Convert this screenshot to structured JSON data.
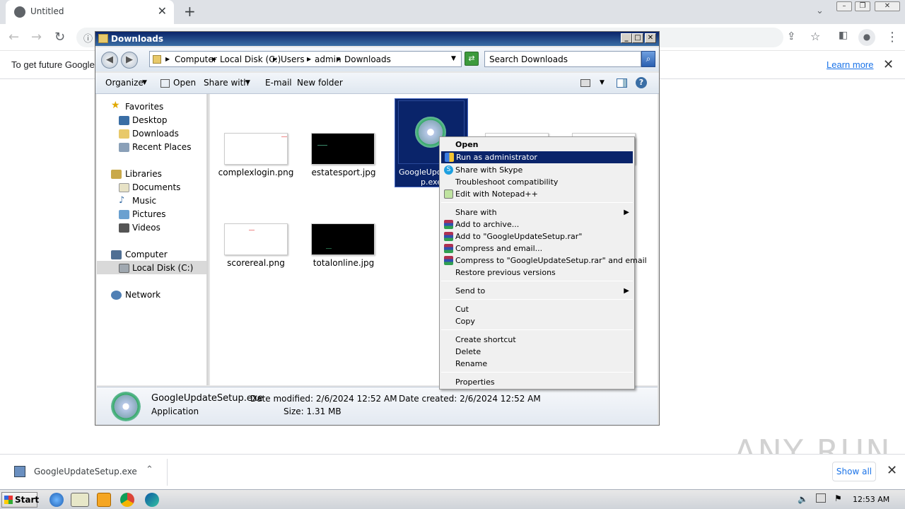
{
  "browser": {
    "tab_title": "Untitled",
    "infobar_message": "To get future Google",
    "learn_more": "Learn more"
  },
  "explorer": {
    "title": "Downloads",
    "breadcrumbs": [
      "Computer",
      "Local Disk (C:)",
      "Users",
      "admin",
      "Downloads"
    ],
    "search_placeholder": "Search Downloads",
    "commands": {
      "organize": "Organize",
      "open": "Open",
      "share_with": "Share with",
      "email": "E-mail",
      "new_folder": "New folder"
    },
    "nav": {
      "favorites": "Favorites",
      "desktop": "Desktop",
      "downloads": "Downloads",
      "recent_places": "Recent Places",
      "libraries": "Libraries",
      "documents": "Documents",
      "music": "Music",
      "pictures": "Pictures",
      "videos": "Videos",
      "computer": "Computer",
      "local_disk": "Local Disk (C:)",
      "network": "Network"
    },
    "files": [
      {
        "name": "complexlogin.png"
      },
      {
        "name": "estatesport.jpg"
      },
      {
        "name": "GoogleUpda",
        "name2": "p.exe"
      },
      {
        "name": "scorereal.png"
      },
      {
        "name": "totalonline.jpg"
      }
    ],
    "details": {
      "filename": "GoogleUpdateSetup.exe",
      "type": "Application",
      "date_modified": "Date modified: 2/6/2024 12:52 AM",
      "size": "Size: 1.31 MB",
      "date_created": "Date created: 2/6/2024 12:52 AM"
    }
  },
  "context_menu": {
    "open": "Open",
    "run_as_admin": "Run as administrator",
    "share_skype": "Share with Skype",
    "troubleshoot": "Troubleshoot compatibility",
    "edit_notepad": "Edit with Notepad++",
    "share_with": "Share with",
    "add_archive": "Add to archive...",
    "add_rar": "Add to \"GoogleUpdateSetup.rar\"",
    "compress_email": "Compress and email...",
    "compress_rar_email": "Compress to \"GoogleUpdateSetup.rar\" and email",
    "restore": "Restore previous versions",
    "send_to": "Send to",
    "cut": "Cut",
    "copy": "Copy",
    "create_shortcut": "Create shortcut",
    "delete": "Delete",
    "rename": "Rename",
    "properties": "Properties"
  },
  "downloads_bar": {
    "filename": "GoogleUpdateSetup.exe",
    "show_all": "Show all"
  },
  "watermark": "ANY RUN",
  "taskbar": {
    "start": "Start",
    "clock": "12:53 AM"
  },
  "colors": {
    "selection": "#0a246a",
    "titlebar": "#0a246a",
    "link": "#1a73e8"
  }
}
